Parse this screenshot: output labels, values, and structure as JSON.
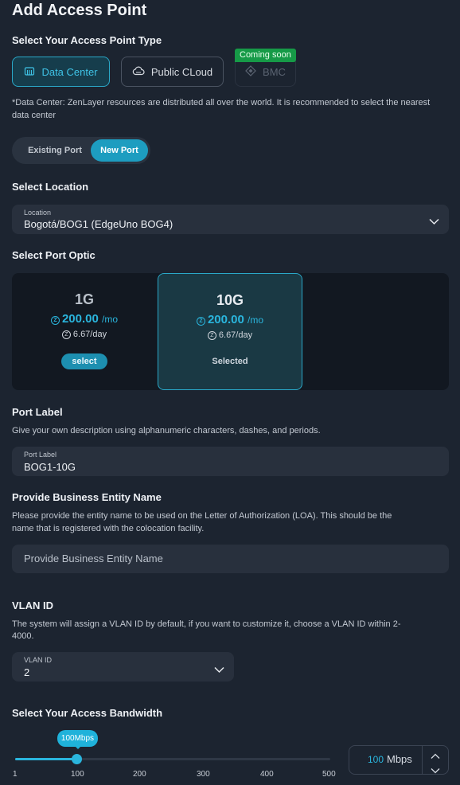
{
  "title": "Add Access Point",
  "type_section": {
    "heading": "Select Your Access Point Type",
    "options": [
      {
        "label": "Data Center",
        "icon": "datacenter-icon",
        "state": "active"
      },
      {
        "label": "Public CLoud",
        "icon": "cloud-icon",
        "state": "normal"
      },
      {
        "label": "BMC",
        "icon": "diamond-icon",
        "state": "disabled",
        "badge": "Coming soon"
      }
    ],
    "note": "*Data Center: ZenLayer resources are distributed all over the world. It is recommended to select the nearest data center"
  },
  "port_mode": {
    "options": [
      "Existing Port",
      "New Port"
    ],
    "selected": "New Port"
  },
  "location": {
    "heading": "Select Location",
    "label": "Location",
    "value": "Bogotá/BOG1 (EdgeUno BOG4)"
  },
  "optic": {
    "heading": "Select Port Optic",
    "cards": [
      {
        "size": "1G",
        "price": "200.00",
        "unit": "/mo",
        "daily": "6.67/day",
        "action": "select",
        "selected": false
      },
      {
        "size": "10G",
        "price": "200.00",
        "unit": "/mo",
        "daily": "6.67/day",
        "action": "Selected",
        "selected": true
      }
    ]
  },
  "port_label": {
    "heading": "Port Label",
    "desc": "Give your own description using alphanumeric characters, dashes, and periods.",
    "label": "Port Label",
    "value": "BOG1-10G"
  },
  "business": {
    "heading": "Provide Business Entity Name",
    "desc1": "Please provide the entity name to be used on the Letter of Authorization (LOA). This should be the",
    "desc2": "name that is registered with the colocation facility.",
    "placeholder": "Provide Business Entity Name"
  },
  "vlan": {
    "heading": "VLAN ID",
    "desc1": "The system will assign a VLAN ID by default, if you want to customize it, choose a VLAN ID within 2-",
    "desc2": "4000.",
    "label": "VLAN ID",
    "value": "2"
  },
  "bandwidth": {
    "heading": "Select Your Access Bandwidth",
    "tooltip": "100Mbps",
    "ticks": [
      "1",
      "100",
      "200",
      "300",
      "400",
      "500"
    ],
    "min": 1,
    "max": 500,
    "value": "100",
    "unit": "Mbps"
  },
  "colors": {
    "accent": "#2ab5dd",
    "badge_green": "#169a47",
    "background": "#1c2430"
  }
}
